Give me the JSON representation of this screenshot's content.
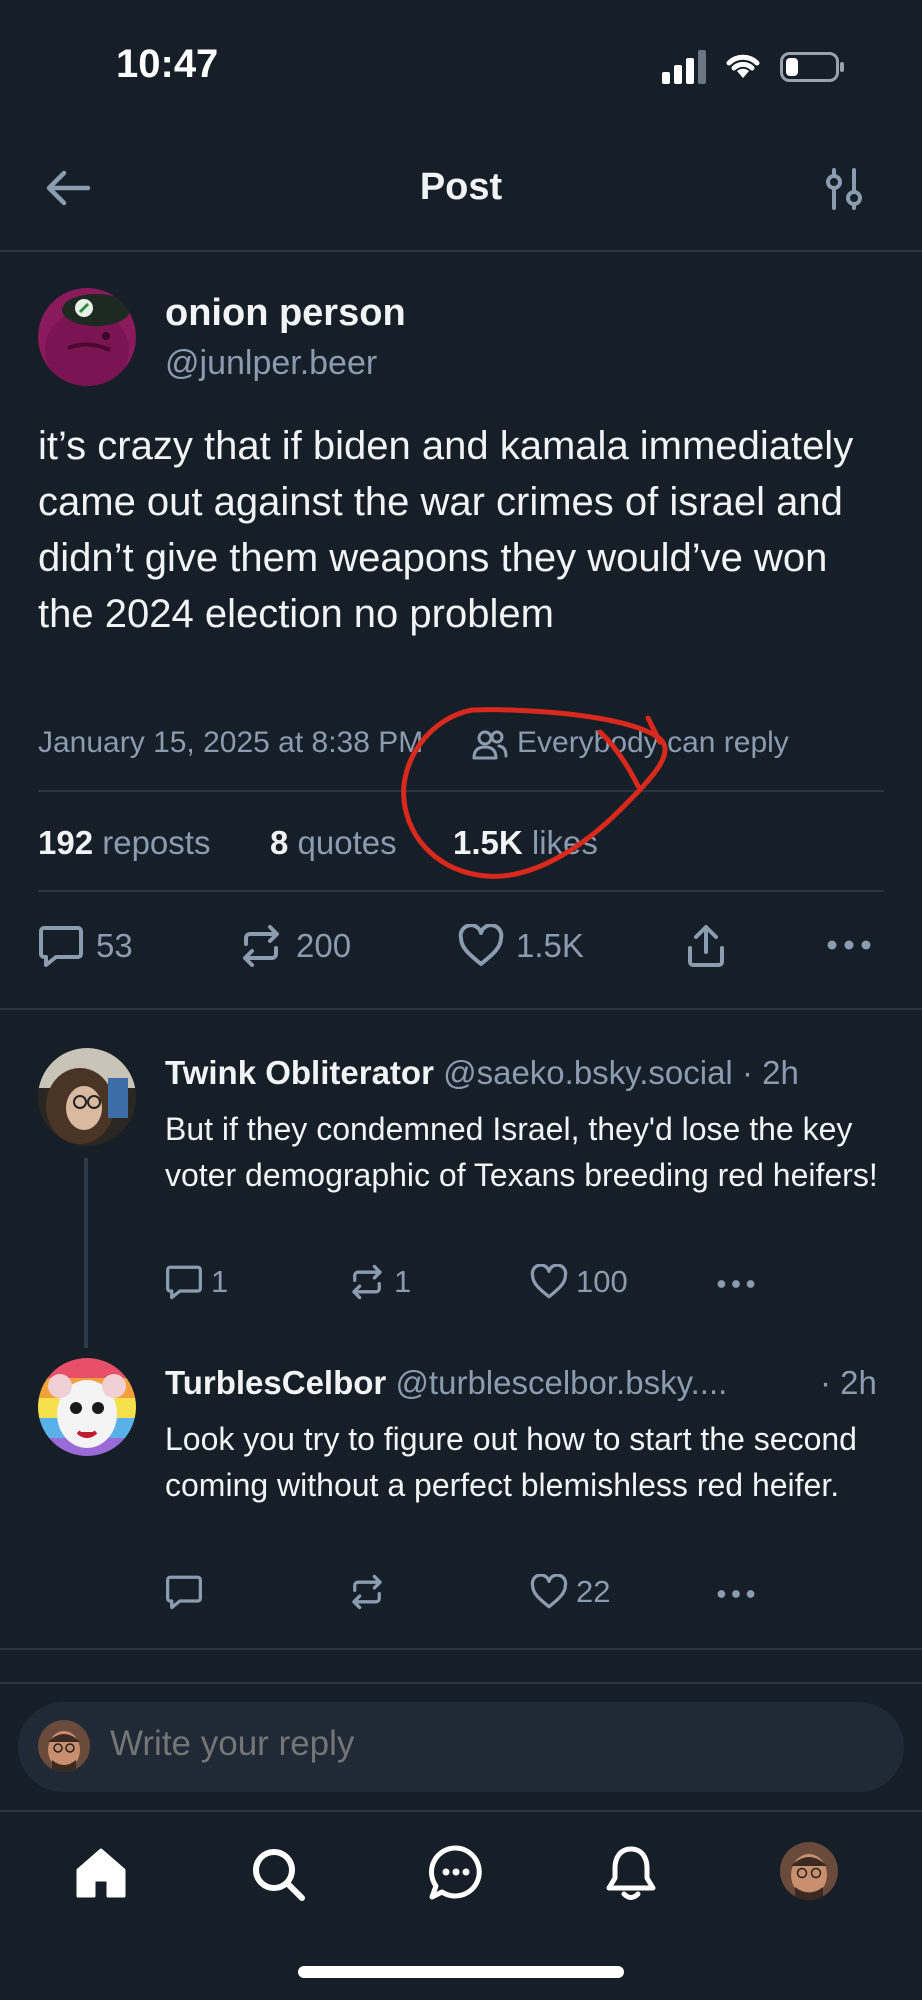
{
  "status_bar": {
    "time": "10:47"
  },
  "header": {
    "title": "Post"
  },
  "post": {
    "author_name": "onion person",
    "author_handle": "@junlper.beer",
    "text": "it’s crazy that if biden and kamala immediately came out against the war crimes of israel and didn’t give them weapons they would’ve won the 2024 election no problem",
    "timestamp": "January 15, 2025 at 8:38 PM",
    "reply_setting": "Everybody can reply",
    "stats": {
      "reposts_count": "192",
      "reposts_label": "reposts",
      "quotes_count": "8",
      "quotes_label": "quotes",
      "likes_count": "1.5K",
      "likes_label": "likes"
    },
    "actions": {
      "replies": "53",
      "reposts": "200",
      "likes": "1.5K"
    }
  },
  "replies": [
    {
      "name": "Twink Obliterator",
      "handle": "@saeko.bsky.social",
      "time": "· 2h",
      "text": "But if they condemned Israel, they'd lose the key voter demographic of Texans breeding red heifers!",
      "replies": "1",
      "reposts": "1",
      "likes": "100"
    },
    {
      "name": "TurblesCelbor",
      "handle": "@turblescelbor.bsky....",
      "time": "· 2h",
      "text": "Look you try to figure out how to start the second coming without a perfect blemishless red heifer.",
      "replies": "",
      "reposts": "",
      "likes": "22"
    }
  ],
  "composer": {
    "placeholder": "Write your reply"
  },
  "annotation": {
    "color": "#d9291c"
  },
  "colors": {
    "background": "#161e27",
    "muted": "#8b9bb0",
    "text": "#f1f3f5"
  },
  "icons": [
    "back-arrow-icon",
    "sliders-icon",
    "people-icon",
    "comment-icon",
    "repost-icon",
    "heart-icon",
    "share-icon",
    "more-icon",
    "home-icon",
    "search-icon",
    "chat-icon",
    "bell-icon"
  ]
}
